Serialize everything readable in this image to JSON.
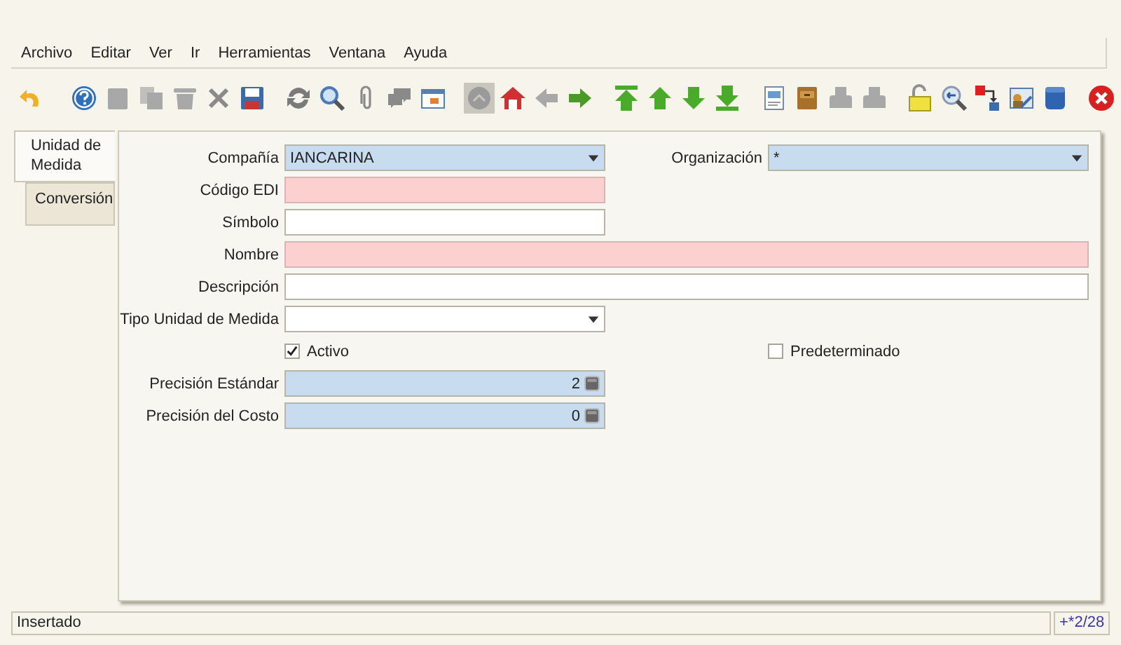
{
  "menu": [
    {
      "label": "Archivo"
    },
    {
      "label": "Editar"
    },
    {
      "label": "Ver"
    },
    {
      "label": "Ir"
    },
    {
      "label": "Herramientas"
    },
    {
      "label": "Ventana"
    },
    {
      "label": "Ayuda"
    }
  ],
  "toolbar": [
    [
      {
        "kind": "undo",
        "disabled": false
      }
    ],
    [
      {
        "kind": "help",
        "disabled": false
      },
      {
        "kind": "new",
        "disabled": true
      },
      {
        "kind": "copy",
        "disabled": true
      },
      {
        "kind": "delete",
        "disabled": true
      },
      {
        "kind": "cross",
        "disabled": false
      },
      {
        "kind": "save",
        "disabled": false
      }
    ],
    [
      {
        "kind": "refresh",
        "disabled": false
      },
      {
        "kind": "find",
        "disabled": false
      },
      {
        "kind": "attach",
        "disabled": false
      },
      {
        "kind": "chat",
        "disabled": false
      },
      {
        "kind": "window",
        "disabled": false
      }
    ],
    [
      {
        "kind": "circle",
        "disabled": false,
        "pressed": true
      },
      {
        "kind": "home",
        "disabled": false
      },
      {
        "kind": "left",
        "disabled": true
      },
      {
        "kind": "right",
        "disabled": false
      }
    ],
    [
      {
        "kind": "first",
        "disabled": false
      },
      {
        "kind": "up",
        "disabled": false
      },
      {
        "kind": "down",
        "disabled": false
      },
      {
        "kind": "last",
        "disabled": false
      }
    ],
    [
      {
        "kind": "document",
        "disabled": false
      },
      {
        "kind": "cabinet",
        "disabled": false
      },
      {
        "kind": "print",
        "disabled": true
      },
      {
        "kind": "print",
        "disabled": true
      }
    ],
    [
      {
        "kind": "lock",
        "disabled": false
      },
      {
        "kind": "zoom",
        "disabled": false
      },
      {
        "kind": "flow",
        "disabled": false
      },
      {
        "kind": "folder",
        "disabled": false
      },
      {
        "kind": "database",
        "disabled": false
      }
    ],
    [
      {
        "kind": "close",
        "disabled": false
      }
    ]
  ],
  "tabs": [
    {
      "label": "Unidad de Medida",
      "selected": true
    },
    {
      "label": "Conversión",
      "selected": false
    }
  ],
  "form": {
    "rows": [
      [
        {
          "kind": "combo",
          "label": "Compañía",
          "value": "IANCARINA",
          "mandatory": true
        },
        {
          "kind": "combo",
          "label": "Organización",
          "value": "*",
          "mandatory": true
        }
      ],
      [
        {
          "kind": "text",
          "label": "Código EDI",
          "mandatory": true
        }
      ],
      [
        {
          "kind": "text",
          "label": "Símbolo",
          "mandatory": false
        }
      ],
      [
        {
          "kind": "text_long",
          "label": "Nombre",
          "mandatory": true
        }
      ],
      [
        {
          "kind": "text_long",
          "label": "Descripción",
          "mandatory": false
        }
      ],
      [
        {
          "kind": "combo",
          "label": "Tipo Unidad de Medida",
          "mandatory": false
        }
      ],
      [
        {
          "kind": "checkbox",
          "label": "Activo",
          "checked": true
        },
        {
          "kind": "checkbox",
          "label": "Predeterminado",
          "checked": false
        }
      ],
      [
        {
          "kind": "number",
          "label": "Precisión Estándar",
          "value": "2",
          "mandatory": true
        }
      ],
      [
        {
          "kind": "number",
          "label": "Precisión del Costo",
          "value": "0",
          "mandatory": true
        }
      ]
    ]
  },
  "status_bar": {
    "message": "Insertado",
    "record": "+*2/28"
  }
}
